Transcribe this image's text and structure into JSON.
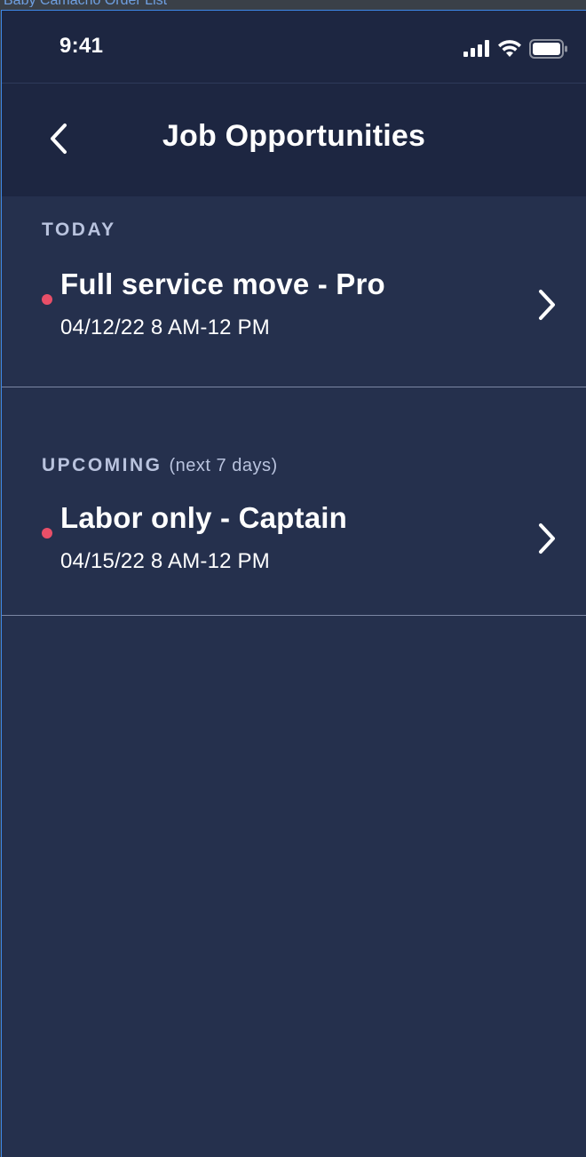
{
  "artboard_label": "Baby Camacho Order List",
  "status_bar": {
    "time": "9:41"
  },
  "nav": {
    "title": "Job Opportunities",
    "back_icon": "chevron-left-icon"
  },
  "sections": [
    {
      "header": "TODAY",
      "subheader": "",
      "jobs": [
        {
          "title": "Full service move - Pro",
          "datetime": "04/12/22 8 AM-12 PM",
          "indicator_color": "#e84f68"
        }
      ]
    },
    {
      "header": "UPCOMING",
      "subheader": "(next 7 days)",
      "jobs": [
        {
          "title": "Labor only - Captain",
          "datetime": "04/15/22 8 AM-12 PM",
          "indicator_color": "#e84f68"
        }
      ]
    }
  ],
  "colors": {
    "background": "#25304d",
    "header_background": "#1d2641",
    "accent_dot": "#e84f68",
    "divider": "#7b86a3"
  }
}
